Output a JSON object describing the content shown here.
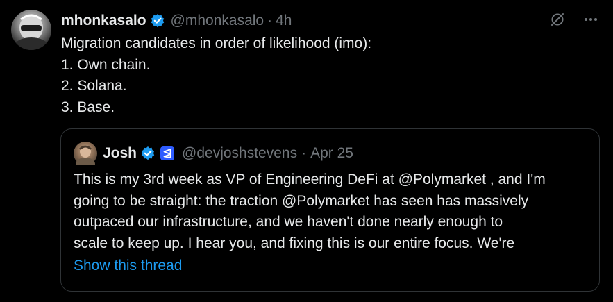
{
  "tweet": {
    "author_name": "mhonkasalo",
    "author_handle": "@mhonkasalo",
    "separator": "·",
    "time": "4h",
    "lines": [
      "Migration candidates in order of likelihood (imo):",
      "1. Own chain.",
      "2. Solana.",
      "3. Base."
    ]
  },
  "icons": {
    "verified": "verified-badge-icon",
    "grok": "grok-icon",
    "more": "more-icon",
    "affiliate": "affiliate-badge-icon"
  },
  "quote": {
    "author_name": "Josh",
    "author_handle": "@devjoshstevens",
    "separator": "·",
    "time": "Apr 25",
    "lines": [
      "This is my 3rd week as VP of Engineering DeFi at @Polymarket , and I'm",
      "going to be straight: the traction @Polymarket has seen has massively",
      "outpaced our infrastructure, and we haven't done nearly enough to",
      "scale to keep up. I hear you, and fixing this is our entire focus. We're"
    ],
    "show_thread": "Show this thread"
  },
  "colors": {
    "background": "#000000",
    "text": "#e7e9ea",
    "muted": "#71767b",
    "accent": "#1d9bf0",
    "border": "#2f3336"
  }
}
